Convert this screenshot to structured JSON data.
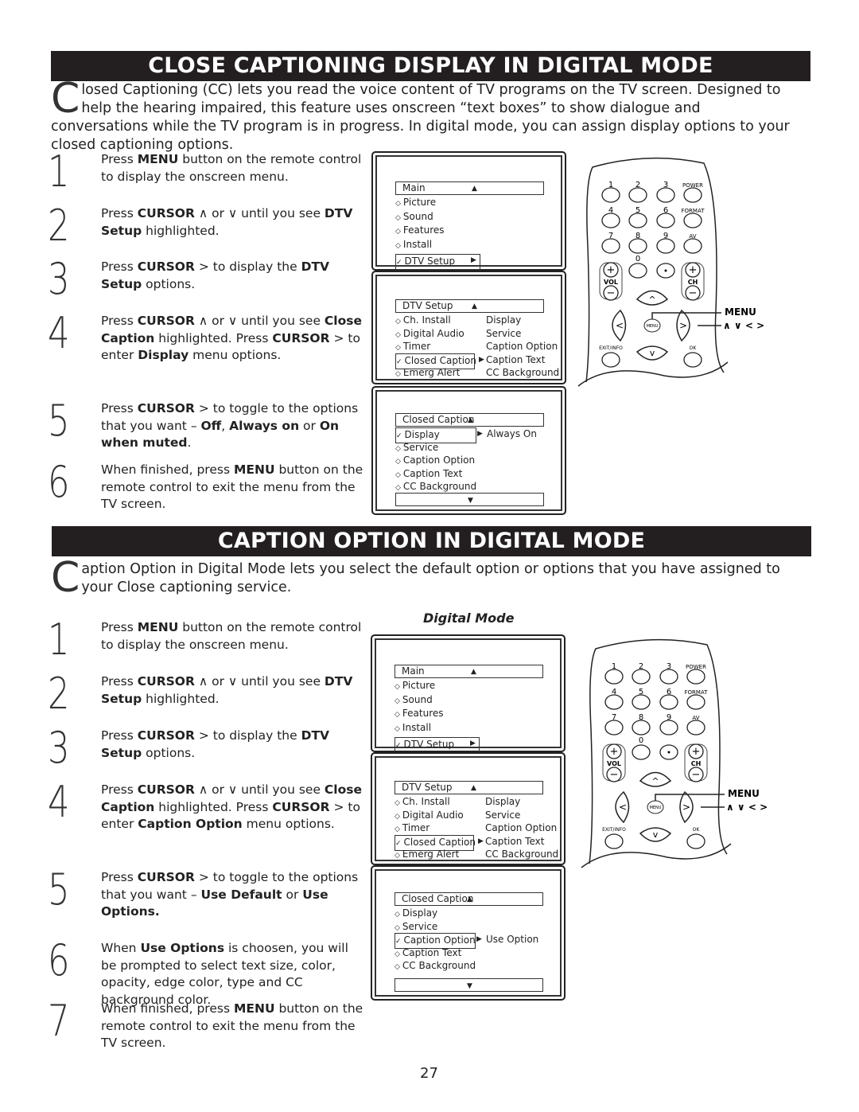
{
  "sections": [
    {
      "title": "CLOSE CAPTIONING DISPLAY IN DIGITAL MODE",
      "intro_initial": "C",
      "intro": "losed Captioning (CC) lets you read the voice content of TV programs on the TV screen.  Designed to help the hearing impaired, this feature uses onscreen “text boxes” to show dialogue and conversations while the TV program is in progress.   In digital mode, you can assign display options to your closed captioning options.",
      "steps": [
        {
          "n": "1",
          "parts": [
            [
              "Press ",
              0
            ],
            [
              "MENU",
              1
            ],
            [
              " button on the remote control to display the onscreen menu.",
              0
            ]
          ]
        },
        {
          "n": "2",
          "parts": [
            [
              "Press ",
              0
            ],
            [
              "CURSOR",
              1
            ],
            [
              " ∧  or  ∨  until you see ",
              0
            ],
            [
              "DTV Setup",
              1
            ],
            [
              " highlighted.",
              0
            ]
          ]
        },
        {
          "n": "3",
          "parts": [
            [
              "Press ",
              0
            ],
            [
              "CURSOR",
              1
            ],
            [
              "  >  to display the ",
              0
            ],
            [
              "DTV Setup",
              1
            ],
            [
              " options.",
              0
            ]
          ]
        },
        {
          "n": "4",
          "parts": [
            [
              "Press ",
              0
            ],
            [
              "CURSOR",
              1
            ],
            [
              " ∧  or  ∨  until you see ",
              0
            ],
            [
              "Close Caption",
              1
            ],
            [
              " highlighted.  Press ",
              0
            ],
            [
              "CURSOR",
              1
            ],
            [
              " >  to enter ",
              0
            ],
            [
              "Display",
              1
            ],
            [
              " menu options.",
              0
            ]
          ]
        },
        {
          "n": "5",
          "parts": [
            [
              "Press ",
              0
            ],
            [
              "CURSOR",
              1
            ],
            [
              " >  to toggle to the options that you want – ",
              0
            ],
            [
              "Off",
              1
            ],
            [
              ", ",
              0
            ],
            [
              "Always on",
              1
            ],
            [
              " or ",
              0
            ],
            [
              "On when muted",
              1
            ],
            [
              ".",
              0
            ]
          ]
        },
        {
          "n": "6",
          "parts": [
            [
              "When finished, press ",
              0
            ],
            [
              "MENU",
              1
            ],
            [
              " button on the remote control to exit the menu from the TV screen.",
              0
            ]
          ]
        }
      ],
      "menus": [
        {
          "header": "Main",
          "items": [
            [
              "◇",
              "Picture"
            ],
            [
              "◇",
              "Sound"
            ],
            [
              "◇",
              "Features"
            ],
            [
              "◇",
              "Install"
            ],
            [
              "✓",
              "DTV Setup",
              1
            ]
          ],
          "right": []
        },
        {
          "header": "DTV Setup",
          "items": [
            [
              "◇",
              "Ch. Install"
            ],
            [
              "◇",
              "Digital Audio"
            ],
            [
              "◇",
              "Timer"
            ],
            [
              "✓",
              "Closed Caption",
              1
            ],
            [
              "◇",
              "Emerg Alert"
            ]
          ],
          "right": [
            "Display",
            "Service",
            "Caption Option",
            "Caption Text",
            "CC Background"
          ]
        },
        {
          "header": "Closed Caption",
          "items": [
            [
              "✓",
              "Display",
              1
            ],
            [
              "◇",
              "Service"
            ],
            [
              "◇",
              "Caption Option"
            ],
            [
              "◇",
              "Caption Text"
            ],
            [
              "◇",
              "CC Background"
            ]
          ],
          "right": [
            "Always On"
          ],
          "bottom": true
        }
      ]
    },
    {
      "title": "CAPTION OPTION IN DIGITAL MODE",
      "intro_initial": "C",
      "intro": "aption Option in Digital Mode lets you select the default option or options that you have assigned to your Close captioning service.",
      "menu_label": "Digital Mode",
      "steps": [
        {
          "n": "1",
          "parts": [
            [
              "Press ",
              0
            ],
            [
              "MENU",
              1
            ],
            [
              " button on the remote control to display the onscreen menu.",
              0
            ]
          ]
        },
        {
          "n": "2",
          "parts": [
            [
              "Press ",
              0
            ],
            [
              "CURSOR",
              1
            ],
            [
              " ∧  or  ∨  until you see ",
              0
            ],
            [
              "DTV Setup",
              1
            ],
            [
              " highlighted.",
              0
            ]
          ]
        },
        {
          "n": "3",
          "parts": [
            [
              "Press ",
              0
            ],
            [
              "CURSOR",
              1
            ],
            [
              "  > to display the ",
              0
            ],
            [
              "DTV Setup",
              1
            ],
            [
              " options.",
              0
            ]
          ]
        },
        {
          "n": "4",
          "parts": [
            [
              "Press ",
              0
            ],
            [
              "CURSOR",
              1
            ],
            [
              " ∧  or  ∨  until you see ",
              0
            ],
            [
              "Close Caption",
              1
            ],
            [
              " highlighted.  Press ",
              0
            ],
            [
              "CURSOR",
              1
            ],
            [
              " >  to enter ",
              0
            ],
            [
              "Caption Option",
              1
            ],
            [
              " menu options.",
              0
            ]
          ]
        },
        {
          "n": "5",
          "parts": [
            [
              "Press ",
              0
            ],
            [
              "CURSOR",
              1
            ],
            [
              " >  to toggle to the options that you want – ",
              0
            ],
            [
              "Use Default",
              1
            ],
            [
              " or ",
              0
            ],
            [
              "Use Options.",
              1
            ]
          ]
        },
        {
          "n": "6",
          "parts": [
            [
              "When ",
              0
            ],
            [
              "Use Options",
              1
            ],
            [
              " is choosen, you will be prompted to select text size, color, opacity, edge color, type and CC background color.",
              0
            ]
          ]
        },
        {
          "n": "7",
          "parts": [
            [
              "When finished, press ",
              0
            ],
            [
              "MENU",
              1
            ],
            [
              " button on the remote control to exit the menu from the TV screen.",
              0
            ]
          ]
        }
      ],
      "menus": [
        {
          "header": "Main",
          "items": [
            [
              "◇",
              "Picture"
            ],
            [
              "◇",
              "Sound"
            ],
            [
              "◇",
              "Features"
            ],
            [
              "◇",
              "Install"
            ],
            [
              "✓",
              "DTV Setup",
              1
            ]
          ],
          "right": []
        },
        {
          "header": "DTV Setup",
          "items": [
            [
              "◇",
              "Ch. Install"
            ],
            [
              "◇",
              "Digital Audio"
            ],
            [
              "◇",
              "Timer"
            ],
            [
              "✓",
              "Closed Caption",
              1
            ],
            [
              "◇",
              "Emerg Alert"
            ]
          ],
          "right": [
            "Display",
            "Service",
            "Caption Option",
            "Caption Text",
            "CC Background"
          ]
        },
        {
          "header": "Closed Caption",
          "items": [
            [
              "◇",
              "Display"
            ],
            [
              "◇",
              "Service"
            ],
            [
              "✓",
              "Caption Option",
              1
            ],
            [
              "◇",
              "Caption Text"
            ],
            [
              "◇",
              "CC Background"
            ]
          ],
          "right": [
            "Use Option"
          ],
          "bottom": true
        }
      ]
    }
  ],
  "remote": {
    "keys": [
      "1",
      "2",
      "3",
      "POWER",
      "4",
      "5",
      "6",
      "FORMAT",
      "7",
      "8",
      "9",
      "AV",
      "0"
    ],
    "vol": "VOL",
    "ch": "CH",
    "menu_key": "MENU",
    "exit": "EXIT/INFO",
    "ok": "OK",
    "callout_menu": "MENU",
    "callout_cursor": "∧  ∨  <  >"
  },
  "page_number": "27"
}
